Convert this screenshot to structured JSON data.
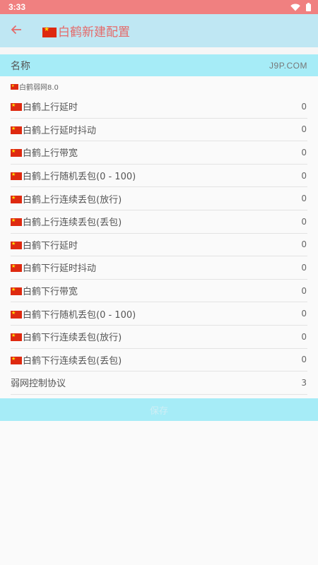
{
  "status_bar": {
    "time": "3:33",
    "wifi_icon": "wifi-icon",
    "battery_icon": "battery-icon"
  },
  "header": {
    "back_icon": "arrow-left-icon",
    "title": "白鹤新建配置"
  },
  "name_row": {
    "label": "名称",
    "value": "J9P.COM"
  },
  "subtitle": "白鹤弱网8.0",
  "items": [
    {
      "label": "白鹤上行延时",
      "value": "0",
      "flag": true
    },
    {
      "label": "白鹤上行延时抖动",
      "value": "0",
      "flag": true
    },
    {
      "label": "白鹤上行带宽",
      "value": "0",
      "flag": true
    },
    {
      "label": "白鹤上行随机丢包(0 - 100)",
      "value": "0",
      "flag": true
    },
    {
      "label": "白鹤上行连续丢包(放行)",
      "value": "0",
      "flag": true
    },
    {
      "label": "白鹤上行连续丢包(丢包)",
      "value": "0",
      "flag": true
    },
    {
      "label": "白鹤下行延时",
      "value": "0",
      "flag": true
    },
    {
      "label": "白鹤下行延时抖动",
      "value": "0",
      "flag": true
    },
    {
      "label": "白鹤下行带宽",
      "value": "0",
      "flag": true
    },
    {
      "label": "白鹤下行随机丢包(0 - 100)",
      "value": "0",
      "flag": true
    },
    {
      "label": "白鹤下行连续丢包(放行)",
      "value": "0",
      "flag": true
    },
    {
      "label": "白鹤下行连续丢包(丢包)",
      "value": "0",
      "flag": true
    },
    {
      "label": "弱网控制协议",
      "value": "3",
      "flag": false
    }
  ],
  "save_button": {
    "label": "保存"
  },
  "colors": {
    "status_bar": "#f08080",
    "app_bar": "#bfe7f3",
    "accent": "#e46a6a",
    "highlight_row": "#a6ecf7"
  }
}
